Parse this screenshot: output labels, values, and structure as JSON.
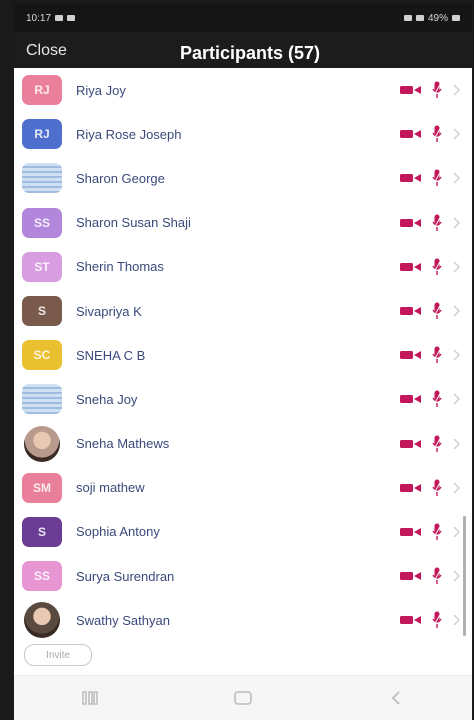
{
  "status_bar": {
    "time": "10:17",
    "battery": "49%"
  },
  "header": {
    "close_label": "Close",
    "title": "Participants (57)"
  },
  "colors": {
    "icon_red": "#c2185b",
    "header_bg": "#1c1c1c",
    "name_text": "#3a4a7a"
  },
  "participants": [
    {
      "name": "Riya Joy",
      "initials": "RJ",
      "avatar_color": "#e97f9a",
      "avatar_style": "solid"
    },
    {
      "name": "Riya Rose Joseph",
      "initials": "RJ",
      "avatar_color": "#4f6fce",
      "avatar_style": "solid"
    },
    {
      "name": "Sharon George",
      "initials": "",
      "avatar_color": "#b8cfee",
      "avatar_style": "stripe"
    },
    {
      "name": "Sharon Susan Shaji",
      "initials": "SS",
      "avatar_color": "#b186db",
      "avatar_style": "solid"
    },
    {
      "name": "Sherin Thomas",
      "initials": "ST",
      "avatar_color": "#d79de0",
      "avatar_style": "solid"
    },
    {
      "name": "Sivapriya K",
      "initials": "S",
      "avatar_color": "#7a5a4c",
      "avatar_style": "solid"
    },
    {
      "name": "SNEHA C B",
      "initials": "SC",
      "avatar_color": "#e8c030",
      "avatar_style": "solid"
    },
    {
      "name": "Sneha Joy",
      "initials": "",
      "avatar_color": "#b8cfee",
      "avatar_style": "stripe"
    },
    {
      "name": "Sneha Mathews",
      "initials": "",
      "avatar_color": "#b89a8c",
      "avatar_style": "photo"
    },
    {
      "name": "soji mathew",
      "initials": "SM",
      "avatar_color": "#e97f9a",
      "avatar_style": "solid"
    },
    {
      "name": "Sophia Antony",
      "initials": "S",
      "avatar_color": "#6a3c94",
      "avatar_style": "solid"
    },
    {
      "name": "Surya Surendran",
      "initials": "SS",
      "avatar_color": "#e796d3",
      "avatar_style": "solid"
    },
    {
      "name": "Swathy Sathyan",
      "initials": "",
      "avatar_color": "#5a4a40",
      "avatar_style": "photo"
    }
  ],
  "invite": {
    "label": "Invite"
  }
}
